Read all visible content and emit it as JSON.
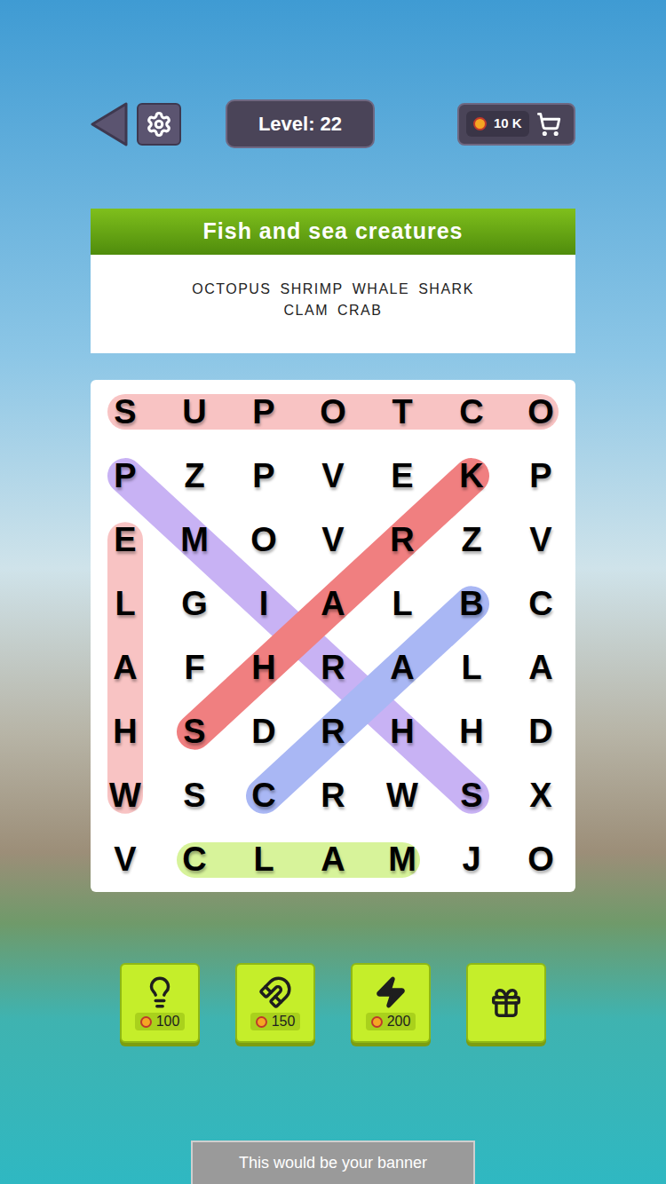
{
  "top_bar": {
    "level": "Level: 22",
    "coins": "10 K"
  },
  "category": {
    "title": "Fish and sea creatures",
    "word_lines": [
      [
        "OCTOPUS",
        "SHRIMP",
        "WHALE",
        "SHARK"
      ],
      [
        "CLAM",
        "CRAB"
      ]
    ]
  },
  "grid": {
    "rows": [
      [
        "S",
        "U",
        "P",
        "O",
        "T",
        "C",
        "O"
      ],
      [
        "P",
        "Z",
        "P",
        "V",
        "E",
        "K",
        "P"
      ],
      [
        "E",
        "M",
        "O",
        "V",
        "R",
        "Z",
        "V"
      ],
      [
        "L",
        "G",
        "I",
        "A",
        "L",
        "B",
        "C"
      ],
      [
        "A",
        "F",
        "H",
        "R",
        "A",
        "L",
        "A"
      ],
      [
        "H",
        "S",
        "D",
        "R",
        "H",
        "H",
        "D"
      ],
      [
        "W",
        "S",
        "C",
        "R",
        "W",
        "S",
        "X"
      ],
      [
        "V",
        "C",
        "L",
        "A",
        "M",
        "J",
        "O"
      ]
    ]
  },
  "found": [
    {
      "color": "#f8c3c3",
      "start": [
        0,
        6
      ],
      "end": [
        0,
        0
      ]
    },
    {
      "color": "#f8c3c3",
      "start": [
        6,
        0
      ],
      "end": [
        2,
        0
      ]
    },
    {
      "color": "#c8b2f4",
      "start": [
        6,
        5
      ],
      "end": [
        1,
        0
      ]
    },
    {
      "color": "#f07f80",
      "start": [
        5,
        1
      ],
      "end": [
        1,
        5
      ]
    },
    {
      "color": "#a9b7f4",
      "start": [
        6,
        2
      ],
      "end": [
        3,
        5
      ]
    },
    {
      "color": "#d7f39a",
      "start": [
        7,
        1
      ],
      "end": [
        7,
        4
      ]
    }
  ],
  "power_ups": [
    {
      "kind": "hint",
      "cost": "100"
    },
    {
      "kind": "magnet",
      "cost": "150"
    },
    {
      "kind": "bolt",
      "cost": "200"
    },
    {
      "kind": "gift",
      "cost": ""
    }
  ],
  "banner": "This would be your banner"
}
